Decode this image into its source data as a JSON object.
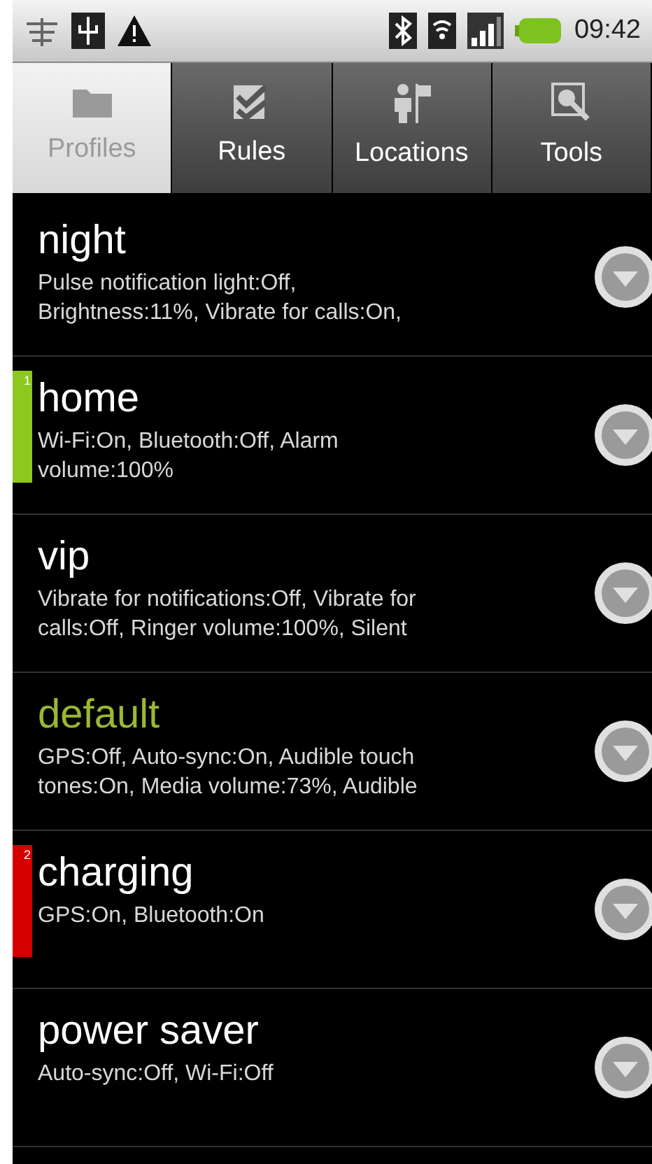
{
  "status_bar": {
    "time": "09:42"
  },
  "tabs": [
    {
      "label": "Profiles",
      "selected": true
    },
    {
      "label": "Rules",
      "selected": false
    },
    {
      "label": "Locations",
      "selected": false
    },
    {
      "label": "Tools",
      "selected": false
    }
  ],
  "profiles": [
    {
      "name": "night",
      "active": false,
      "lines": [
        "Pulse notification light:Off,",
        "Brightness:11%, Vibrate for calls:On,"
      ]
    },
    {
      "name": "home",
      "active": false,
      "marker": {
        "label": "1",
        "color": "#8cc81e"
      },
      "lines": [
        "Wi-Fi:On, Bluetooth:Off, Alarm",
        "volume:100%"
      ]
    },
    {
      "name": "vip",
      "active": false,
      "lines": [
        "Vibrate for notifications:Off, Vibrate for",
        "calls:Off, Ringer volume:100%, Silent"
      ]
    },
    {
      "name": "default",
      "active": true,
      "lines": [
        "GPS:Off, Auto-sync:On, Audible touch",
        "tones:On, Media volume:73%, Audible"
      ]
    },
    {
      "name": "charging",
      "active": false,
      "marker": {
        "label": "2",
        "color": "#d40000"
      },
      "lines": [
        "GPS:On, Bluetooth:On"
      ]
    },
    {
      "name": "power saver",
      "active": false,
      "lines": [
        "Auto-sync:Off, Wi-Fi:Off"
      ]
    }
  ]
}
